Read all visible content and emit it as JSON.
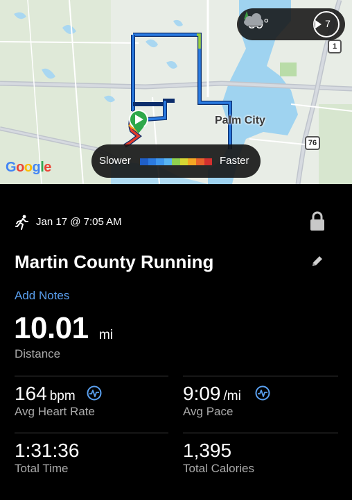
{
  "map": {
    "place_label": "Palm City",
    "google_logo": [
      "G",
      "o",
      "o",
      "g",
      "l",
      "e"
    ],
    "route_shields": [
      "1",
      "76"
    ],
    "start_marker_icon": "play-icon"
  },
  "weather": {
    "temperature": "59°",
    "icon": "cloudy-night-icon",
    "wind_speed": "7",
    "wind_icon": "wind-direction-icon"
  },
  "pace_legend": {
    "slower_label": "Slower",
    "faster_label": "Faster",
    "colors": [
      "#1f5fc8",
      "#2b7ae0",
      "#3f97ee",
      "#59b5f2",
      "#8fd14f",
      "#d6d633",
      "#f5a623",
      "#e8632b",
      "#d2302f"
    ]
  },
  "activity": {
    "type_icon": "running-icon",
    "datetime": "Jan 17 @ 7:05 AM",
    "title": "Martin County Running",
    "add_notes": "Add Notes"
  },
  "distance": {
    "value": "10.01",
    "unit": "mi",
    "label": "Distance"
  },
  "stats": [
    {
      "value": "164",
      "unit": "bpm",
      "label": "Avg Heart Rate",
      "has_icon": true
    },
    {
      "value": "9:09",
      "unit": "/mi",
      "label": "Avg Pace",
      "has_icon": true
    },
    {
      "value": "1:31:36",
      "unit": "",
      "label": "Total Time",
      "has_icon": false
    },
    {
      "value": "1,395",
      "unit": "",
      "label": "Total Calories",
      "has_icon": false
    }
  ]
}
